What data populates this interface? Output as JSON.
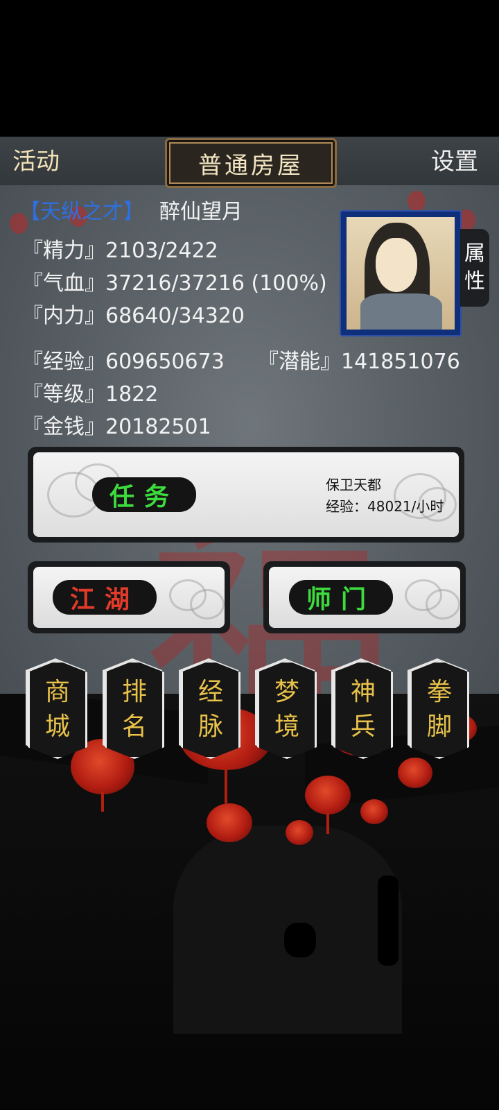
{
  "header": {
    "left_label": "活动",
    "title": "普通房屋",
    "right_label": "设置"
  },
  "character": {
    "talent": "【天纵之才】",
    "name": "醉仙望月",
    "attr_tab": [
      "属",
      "性"
    ],
    "stats": {
      "energy": "『精力』2103/2422",
      "health": "『气血』37216/37216 (100%)",
      "internal": "『内力』68640/34320",
      "exp": "『经验』609650673",
      "potential": "『潜能』141851076",
      "level": "『等级』1822",
      "money": "『金钱』20182501"
    }
  },
  "quest": {
    "button_label": "任务",
    "name": "保卫天都",
    "exp_rate": "经验：48021/小时"
  },
  "buttons": {
    "jianghu": "江湖",
    "shimen": "师门"
  },
  "menu": [
    {
      "top": "商",
      "bottom": "城"
    },
    {
      "top": "排",
      "bottom": "名"
    },
    {
      "top": "经",
      "bottom": "脉"
    },
    {
      "top": "梦",
      "bottom": "境"
    },
    {
      "top": "神",
      "bottom": "兵"
    },
    {
      "top": "拳",
      "bottom": "脚"
    }
  ],
  "colors": {
    "talent": "#2f6fe0",
    "quest_green": "#3ddc3d",
    "jianghu_red": "#e23a2a",
    "menu_gold": "#e8c24a"
  }
}
